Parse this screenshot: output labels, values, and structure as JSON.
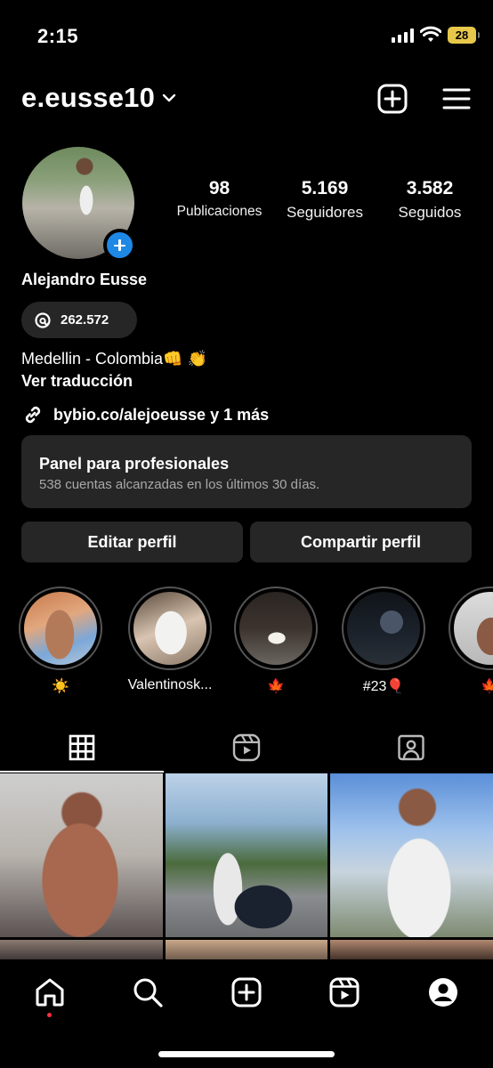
{
  "status_bar": {
    "time": "2:15",
    "battery": "28",
    "battery_color": "#e7c84a",
    "icons": [
      "cellular-signal-icon",
      "wifi-icon",
      "battery-icon"
    ]
  },
  "header": {
    "username": "e.eusse10",
    "icons": [
      "chevron-down-icon",
      "create-post-icon",
      "menu-icon"
    ]
  },
  "profile": {
    "full_name": "Alejandro Eusse",
    "stats": [
      {
        "value": "98",
        "label": "Publicaciones"
      },
      {
        "value": "5.169",
        "label": "Seguidores"
      },
      {
        "value": "3.582",
        "label": "Seguidos"
      }
    ],
    "threads_count": "262.572",
    "bio": "Medellin - Colombia👊 👏",
    "translate_label": "Ver traducción",
    "link_text": "bybio.co/alejoeusse y 1 más"
  },
  "pro_panel": {
    "title": "Panel para profesionales",
    "subtitle": "538 cuentas alcanzadas en los últimos 30 días."
  },
  "actions": {
    "edit_label": "Editar perfil",
    "share_label": "Compartir perfil"
  },
  "highlights": [
    {
      "caption": "☀️"
    },
    {
      "caption": "Valentinosk..."
    },
    {
      "caption": "🍁"
    },
    {
      "caption": "#23🎈"
    },
    {
      "caption": "🍁"
    }
  ],
  "tabs": [
    {
      "name": "grid",
      "icon": "grid-icon",
      "selected": true
    },
    {
      "name": "reels",
      "icon": "reels-icon",
      "selected": false
    },
    {
      "name": "tagged",
      "icon": "tagged-icon",
      "selected": false
    }
  ],
  "bottom_nav": [
    "home-icon",
    "search-icon",
    "create-icon",
    "reels-icon",
    "profile-icon"
  ],
  "colors": {
    "background": "#000000",
    "surface": "#262626",
    "accent_blue": "#1e88e5",
    "notification_dot": "#ff3040"
  }
}
